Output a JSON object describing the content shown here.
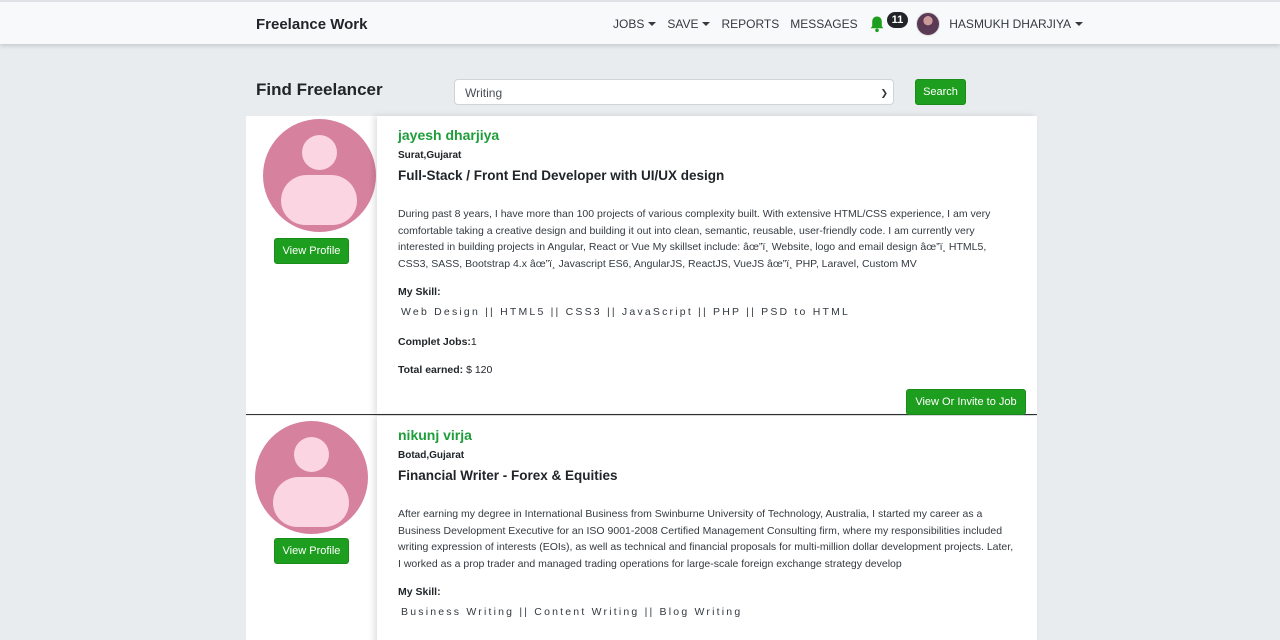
{
  "navbar": {
    "brand": "Freelance Work",
    "items": [
      {
        "label": "JOBS",
        "dropdown": true
      },
      {
        "label": "SAVE",
        "dropdown": true
      },
      {
        "label": "REPORTS",
        "dropdown": false
      },
      {
        "label": "MESSAGES",
        "dropdown": false
      }
    ],
    "notifications_count": "11",
    "user_name": "HASMUKH DHARJIYA"
  },
  "search": {
    "title": "Find Freelancer",
    "selected_category": "Writing",
    "button_label": "Search"
  },
  "freelancers": [
    {
      "name": "jayesh dharjiya",
      "location": "Surat,Gujarat",
      "headline": "Full-Stack / Front End Developer with UI/UX design",
      "description": "During past 8 years, I have more than 100 projects of various complexity built. With extensive HTML/CSS experience, I am very comfortable taking a creative design and building it out into clean, semantic, reusable, user-friendly code. I am currently very interested in building projects in Angular, React or Vue My skillset include: âœ”ï¸ Website, logo and email design âœ”ï¸ HTML5, CSS3, SASS, Bootstrap 4.x âœ”ï¸ Javascript ES6, AngularJS, ReactJS, VueJS âœ”ï¸ PHP, Laravel, Custom MV",
      "skill_label": "My Skill:",
      "skills": "Web Design || HTML5 || CSS3 || JavaScript || PHP || PSD to HTML",
      "jobs_label": "Complet Jobs:",
      "jobs_value": "1",
      "earned_label": "Total earned:",
      "earned_value": "$ 120",
      "profile_button": "View Profile",
      "invite_button": "View Or Invite to Job"
    },
    {
      "name": "nikunj virja",
      "location": "Botad,Gujarat",
      "headline": "Financial Writer - Forex & Equities",
      "description": "After earning my degree in International Business from Swinburne University of Technology, Australia, I started my career as a Business Development Executive for an ISO 9001-2008 Certified Management Consulting firm, where my responsibilities included writing expression of interests (EOIs), as well as technical and financial proposals for multi-million dollar development projects. Later, I worked as a prop trader and managed trading operations for large-scale foreign exchange strategy develop",
      "skill_label": "My Skill:",
      "skills": "Business Writing || Content Writing || Blog Writing",
      "profile_button": "View Profile"
    }
  ],
  "colors": {
    "accent_green": "#1e9e1e",
    "name_green": "#1e9e3a",
    "avatar_pink": "#d6829e"
  }
}
